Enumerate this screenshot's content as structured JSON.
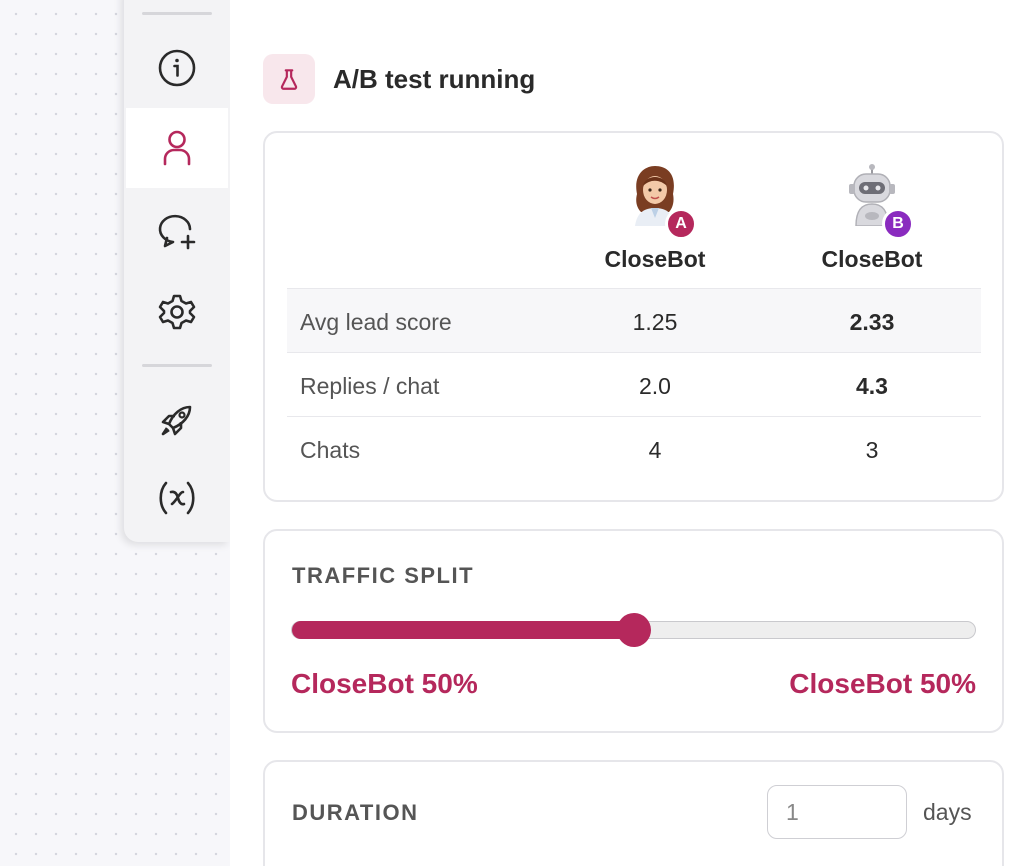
{
  "header": {
    "title": "A/B test running",
    "icon": "flask-icon"
  },
  "rail": {
    "items": [
      {
        "name": "info",
        "icon": "info-icon",
        "active": false
      },
      {
        "name": "user",
        "icon": "user-icon",
        "active": true
      },
      {
        "name": "add-chat",
        "icon": "chat-plus-icon",
        "active": false
      },
      {
        "name": "settings",
        "icon": "gear-icon",
        "active": false
      },
      {
        "name": "launch",
        "icon": "rocket-icon",
        "active": false
      },
      {
        "name": "variables",
        "icon": "variable-icon",
        "active": false
      }
    ]
  },
  "comparison": {
    "bots": [
      {
        "name": "CloseBot",
        "badge": "A",
        "badge_color": "#b5285c",
        "avatar": "woman-avatar"
      },
      {
        "name": "CloseBot",
        "badge": "B",
        "badge_color": "#8a2bbf",
        "avatar": "robot-avatar"
      }
    ],
    "rows": [
      {
        "label": "Avg lead score",
        "a": "1.25",
        "b": "2.33"
      },
      {
        "label": "Replies / chat",
        "a": "2.0",
        "b": "4.3"
      },
      {
        "label": "Chats",
        "a": "4",
        "b": "3"
      }
    ]
  },
  "traffic": {
    "label": "TRAFFIC SPLIT",
    "split_fraction": 0.5,
    "left_label": "CloseBot 50%",
    "right_label": "CloseBot 50%"
  },
  "duration": {
    "label": "DURATION",
    "value": "1",
    "unit": "days"
  },
  "colors": {
    "accent": "#b5285c",
    "badge_b": "#8a2bbf",
    "accent_bg": "#f8e7ec"
  }
}
